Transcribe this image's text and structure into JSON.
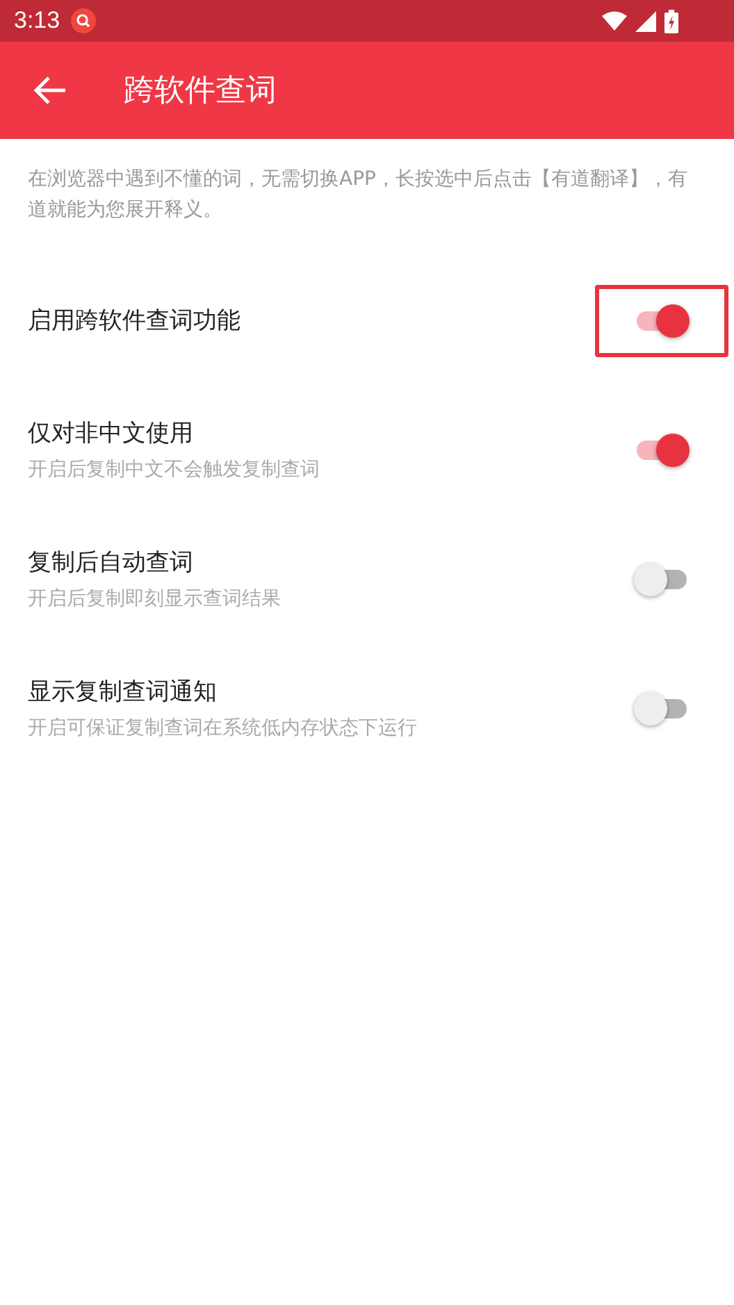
{
  "status_bar": {
    "time": "3:13"
  },
  "app_bar": {
    "title": "跨软件查词"
  },
  "description": "在浏览器中遇到不懂的词，无需切换APP，长按选中后点击【有道翻译】，有道就能为您展开释义。",
  "settings": [
    {
      "title": "启用跨软件查词功能",
      "on": true,
      "highlighted": true
    },
    {
      "title": "仅对非中文使用",
      "subtitle": "开启后复制中文不会触发复制查词",
      "on": true,
      "highlighted": false
    },
    {
      "title": "复制后自动查词",
      "subtitle": "开启后复制即刻显示查词结果",
      "on": false,
      "highlighted": false
    },
    {
      "title": "显示复制查词通知",
      "subtitle": "开启可保证复制查词在系统低内存状态下运行",
      "on": false,
      "highlighted": false
    }
  ]
}
